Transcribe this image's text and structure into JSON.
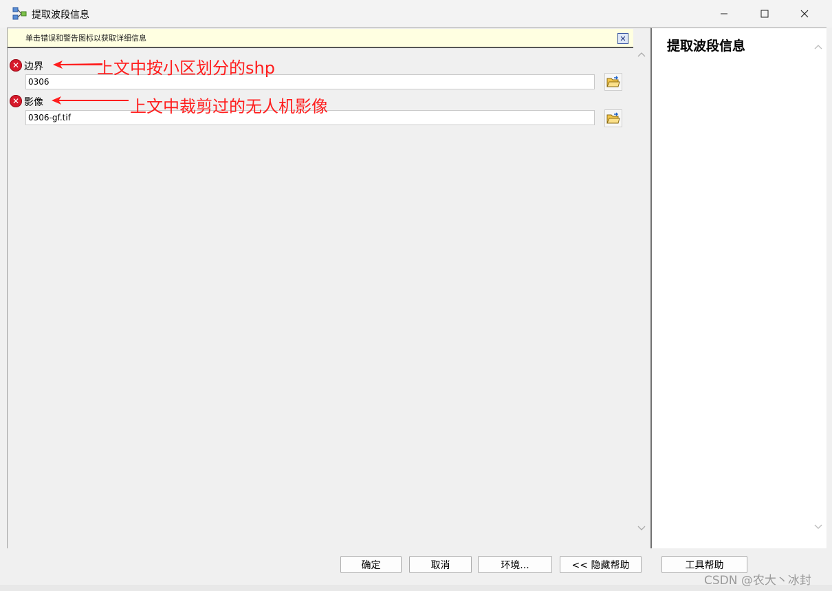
{
  "window": {
    "title": "提取波段信息",
    "icon": "model-tool-icon",
    "controls": [
      "minimize-icon",
      "maximize-icon",
      "close-icon"
    ]
  },
  "message_bar": {
    "text": "单击错误和警告图标以获取详细信息",
    "close_glyph": "✕"
  },
  "fields": [
    {
      "label": "边界",
      "value": "0306",
      "status_icon": "error-icon",
      "browse_icon": "open-folder-icon",
      "annotation": "上文中按小区划分的shp"
    },
    {
      "label": "影像",
      "value": "0306-gf.tif",
      "status_icon": "error-icon",
      "browse_icon": "open-folder-icon",
      "annotation": "上文中裁剪过的无人机影像"
    }
  ],
  "error_glyph": "✕",
  "help_panel": {
    "title": "提取波段信息"
  },
  "buttons": {
    "ok": "确定",
    "cancel": "取消",
    "environments": "环境...",
    "hide_help": "<< 隐藏帮助",
    "tool_help": "工具帮助"
  },
  "watermark": "CSDN @农大丶冰封",
  "colors": {
    "annotation": "#ff1e1e",
    "message_bar_bg": "#ffffe1",
    "error": "#d7182a"
  }
}
